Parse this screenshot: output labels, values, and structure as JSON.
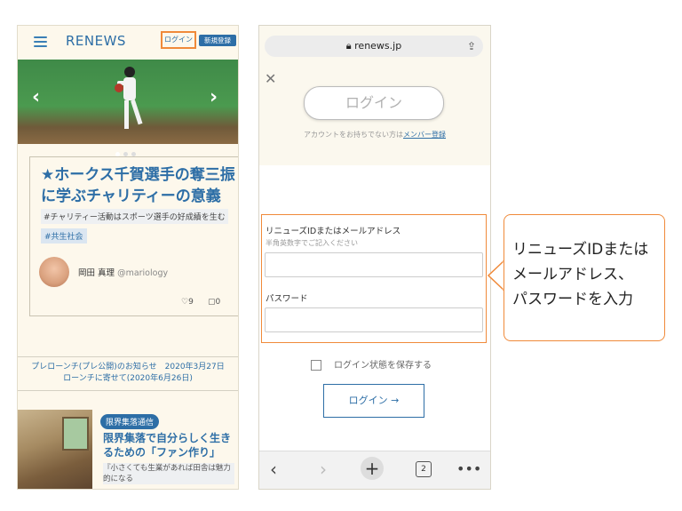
{
  "left": {
    "logo": "RENEWS",
    "login_label": "ログイン",
    "register_label": "新規登録",
    "hero_prev": "‹",
    "hero_next": "›",
    "article": {
      "title": "★ホークス千賀選手の奪三振に学ぶチャリティーの意義",
      "tag_text": "#チャリティー活動はスポーツ選手の好成績を生む",
      "tag_badge": "#共生社会",
      "author_name": "岡田 真理",
      "author_handle": "@mariology",
      "likes": "9",
      "comments": "0"
    },
    "notice_line1": "プレローンチ(プレ公開)のお知らせ　2020年3月27日",
    "notice_line2": "ローンチに寄せて(2020年6月26日)",
    "second_article": {
      "category": "限界集落通信",
      "title": "限界集落で自分らしく生きるための「ファン作り」",
      "subtitle": "『小さくても生業があれば田舎は魅力的になる"
    }
  },
  "right": {
    "url": "renews.jp",
    "login_title": "ログイン",
    "account_prompt": "アカウントをお持ちでない方は",
    "member_register": "メンバー登録",
    "id_label": "リニューズIDまたはメールアドレス",
    "id_hint": "半角英数字でご記入ください",
    "id_value": "",
    "password_label": "パスワード",
    "password_value": "",
    "remember_label": "ログイン状態を保存する",
    "login_button": "ログイン →",
    "tab_count": "2"
  },
  "callout": {
    "line1": "リニューズIDまたは",
    "line2": "メールアドレス、",
    "line3": "パスワードを入力"
  },
  "colors": {
    "brand_blue": "#2d6ea6",
    "highlight_orange": "#f08a3a",
    "cream_bg": "#fdf8ec"
  }
}
